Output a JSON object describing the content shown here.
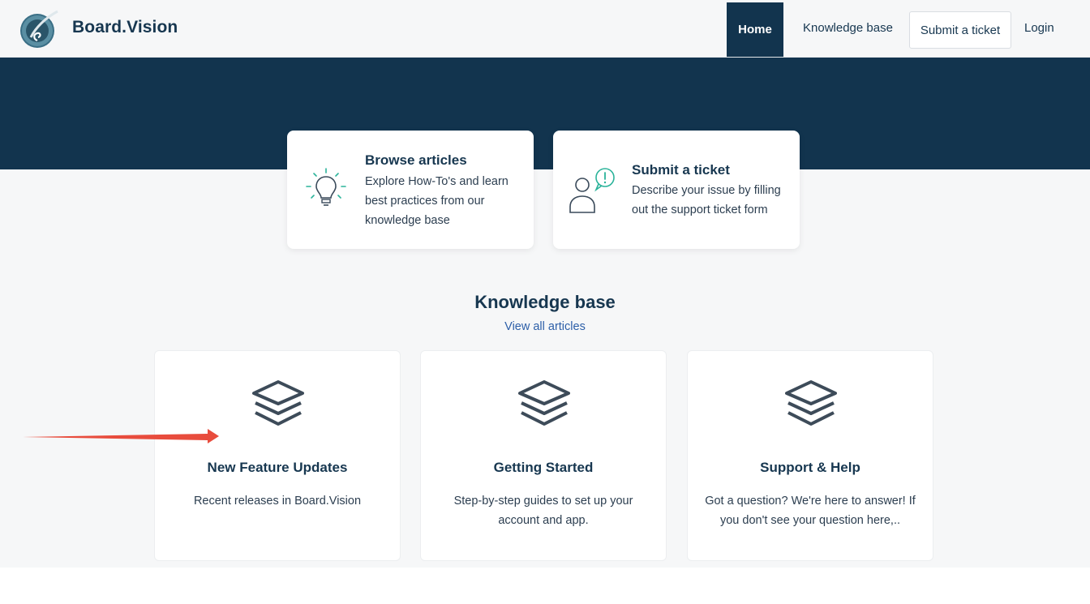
{
  "header": {
    "brand": "Board.Vision",
    "nav": {
      "home": "Home",
      "knowledge_base": "Knowledge base",
      "submit_ticket": "Submit a ticket",
      "login": "Login"
    }
  },
  "actions": [
    {
      "title": "Browse articles",
      "description": "Explore How-To's and learn best practices from our knowledge base",
      "icon": "lightbulb-icon"
    },
    {
      "title": "Submit a ticket",
      "description": "Describe your issue by filling out the support ticket form",
      "icon": "person-alert-icon"
    }
  ],
  "knowledge_base": {
    "title": "Knowledge base",
    "view_all": "View all articles",
    "categories": [
      {
        "name": "New Feature Updates",
        "description": "Recent releases in Board.Vision",
        "icon": "layers-icon"
      },
      {
        "name": "Getting Started",
        "description": "Step-by-step guides to set up your account and app.",
        "icon": "layers-icon"
      },
      {
        "name": "Support & Help",
        "description": "Got a question? We're here to answer! If you don't see your question here,..",
        "icon": "layers-icon"
      }
    ]
  },
  "colors": {
    "navy": "#12344e",
    "accent_teal": "#2bb39a",
    "link": "#2d5fa8",
    "annotation_arrow": "#e84c3d"
  }
}
